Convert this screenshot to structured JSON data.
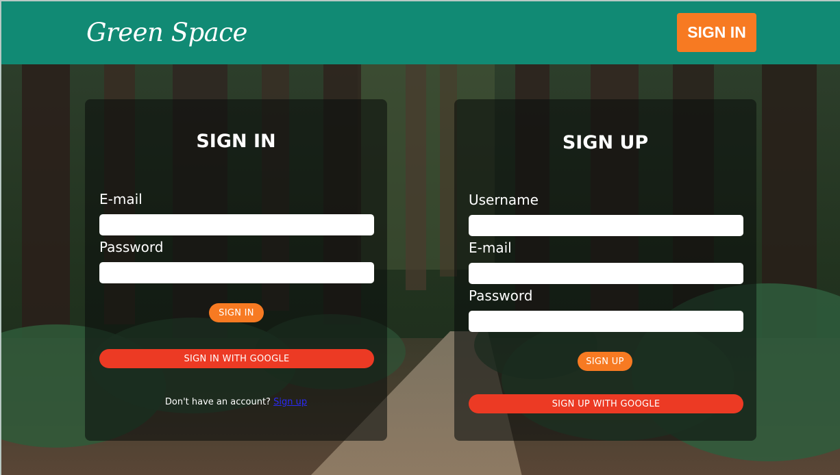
{
  "header": {
    "logo": "Green Space",
    "sign_in_label": "SIGN IN"
  },
  "signin_card": {
    "title": "SIGN IN",
    "email_label": "E-mail",
    "password_label": "Password",
    "submit_label": "SIGN IN",
    "google_label": "SIGN IN WITH GOOGLE",
    "footer_text": "Don't have an account?",
    "footer_link": "Sign up"
  },
  "signup_card": {
    "title": "SIGN UP",
    "username_label": "Username",
    "email_label": "E-mail",
    "password_label": "Password",
    "submit_label": "SIGN UP",
    "google_label": "SIGN UP WITH GOOGLE"
  },
  "colors": {
    "header": "#118a74",
    "accent_orange": "#f77a22",
    "google_red": "#ec3a24",
    "link_blue": "#2a2af5"
  },
  "background": "forest-road-photo"
}
